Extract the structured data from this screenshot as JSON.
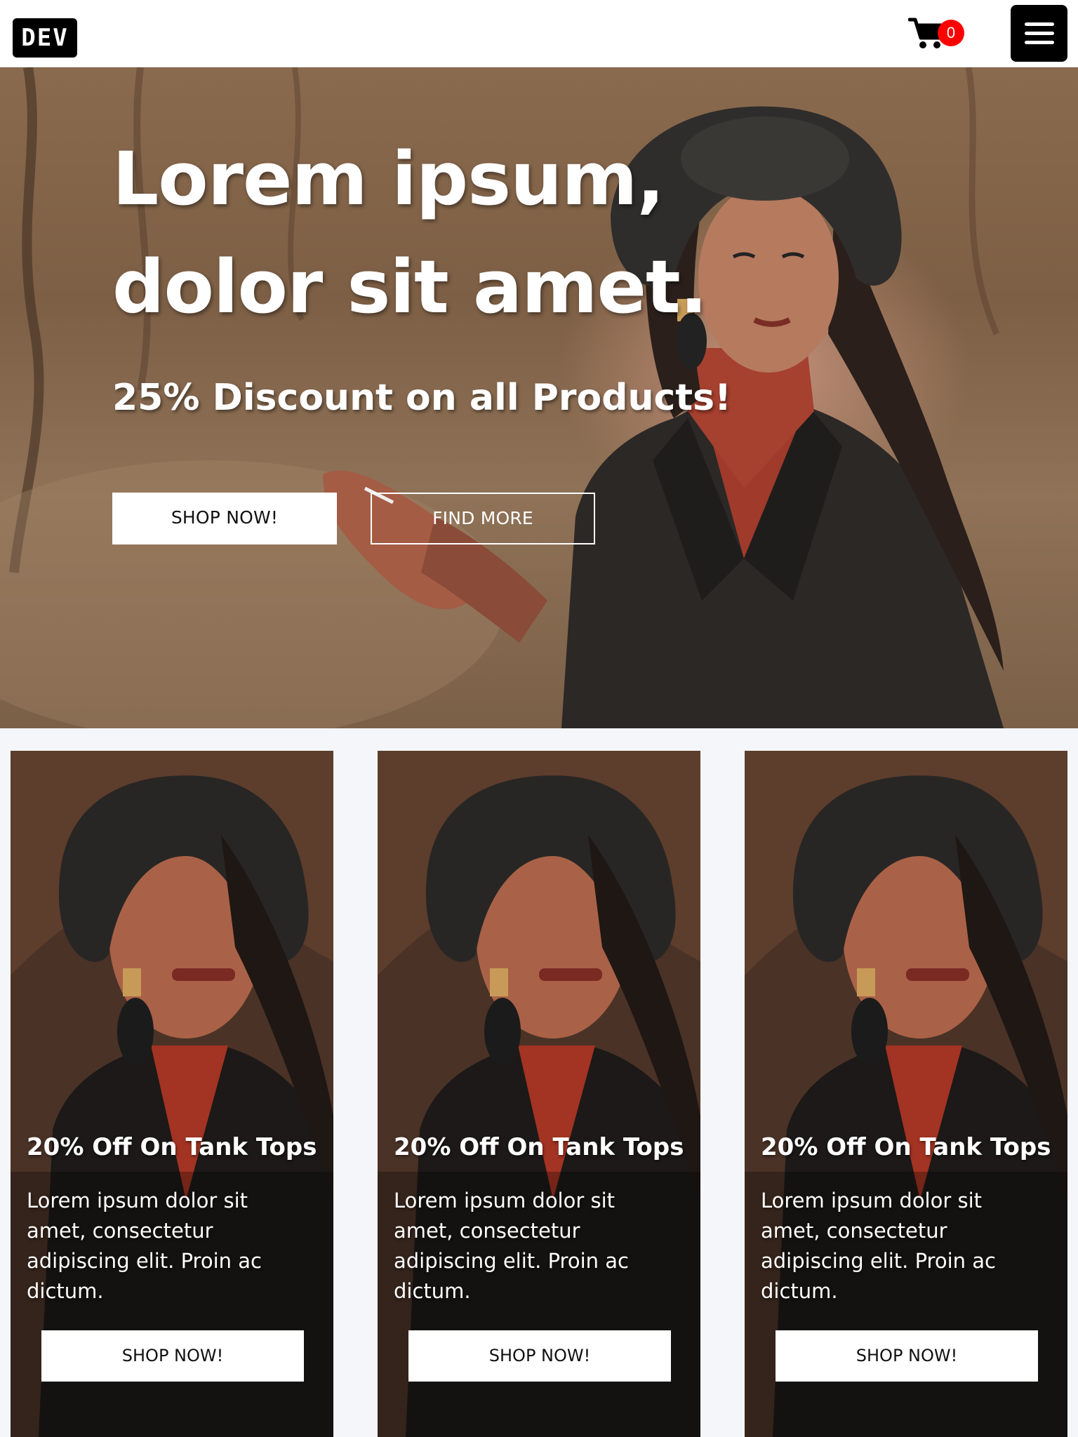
{
  "header": {
    "logo_text": "DEV",
    "cart_count": "0",
    "cart_icon": "cart-icon",
    "menu_icon": "hamburger-menu-icon"
  },
  "hero": {
    "title_line1": "Lorem ipsum,",
    "title_line2": "dolor sit amet.",
    "subtitle": "25% Discount on all Products!",
    "primary_button": "SHOP NOW!",
    "secondary_button": "FIND MORE"
  },
  "cards": [
    {
      "title": "20% Off On Tank Tops",
      "text": "Lorem ipsum dolor sit amet, consectetur adipiscing elit. Proin ac dictum.",
      "button": "SHOP NOW!"
    },
    {
      "title": "20% Off On Tank Tops",
      "text": "Lorem ipsum dolor sit amet, consectetur adipiscing elit. Proin ac dictum.",
      "button": "SHOP NOW!"
    },
    {
      "title": "20% Off On Tank Tops",
      "text": "Lorem ipsum dolor sit amet, consectetur adipiscing elit. Proin ac dictum.",
      "button": "SHOP NOW!"
    }
  ],
  "colors": {
    "header_bg": "#ffffff",
    "page_bg": "#f4f6f9",
    "badge": "#ff0000",
    "logo_bg": "#000000",
    "button_bg": "#ffffff"
  }
}
